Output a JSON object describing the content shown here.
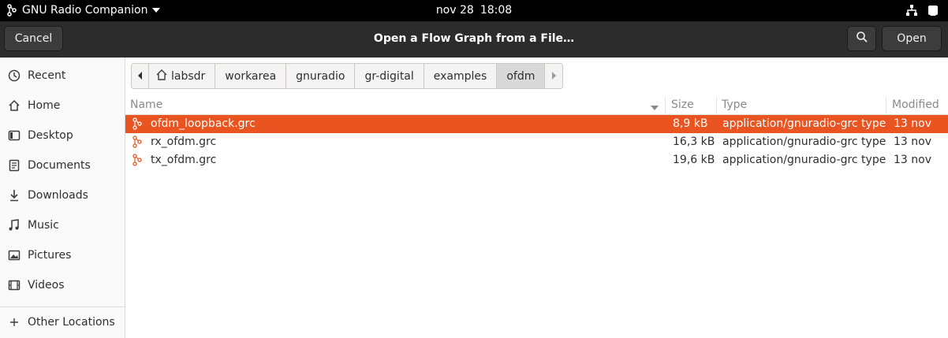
{
  "topbar": {
    "app_name": "GNU Radio Companion",
    "date": "nov 28",
    "time": "18:08"
  },
  "header": {
    "cancel_label": "Cancel",
    "title": "Open a Flow Graph from a File…",
    "open_label": "Open"
  },
  "sidebar": {
    "items": [
      {
        "label": "Recent",
        "icon": "clock-icon"
      },
      {
        "label": "Home",
        "icon": "home-icon"
      },
      {
        "label": "Desktop",
        "icon": "desktop-icon"
      },
      {
        "label": "Documents",
        "icon": "document-icon"
      },
      {
        "label": "Downloads",
        "icon": "download-icon"
      },
      {
        "label": "Music",
        "icon": "music-icon"
      },
      {
        "label": "Pictures",
        "icon": "picture-icon"
      },
      {
        "label": "Videos",
        "icon": "video-icon"
      }
    ],
    "other_locations": "Other Locations"
  },
  "pathbar": {
    "crumbs": [
      "labsdr",
      "workarea",
      "gnuradio",
      "gr-digital",
      "examples",
      "ofdm"
    ],
    "active": "ofdm"
  },
  "list": {
    "columns": {
      "name": "Name",
      "size": "Size",
      "type": "Type",
      "modified": "Modified"
    },
    "rows": [
      {
        "name": "ofdm_loopback.grc",
        "size": "8,9 kB",
        "type": "application/gnuradio-grc type",
        "modified": "13 nov",
        "selected": true
      },
      {
        "name": "rx_ofdm.grc",
        "size": "16,3 kB",
        "type": "application/gnuradio-grc type",
        "modified": "13 nov",
        "selected": false
      },
      {
        "name": "tx_ofdm.grc",
        "size": "19,6 kB",
        "type": "application/gnuradio-grc type",
        "modified": "13 nov",
        "selected": false
      }
    ]
  },
  "colors": {
    "accent": "#e95420",
    "header_bg": "#2c2c2c",
    "topbar_bg": "#000000"
  }
}
